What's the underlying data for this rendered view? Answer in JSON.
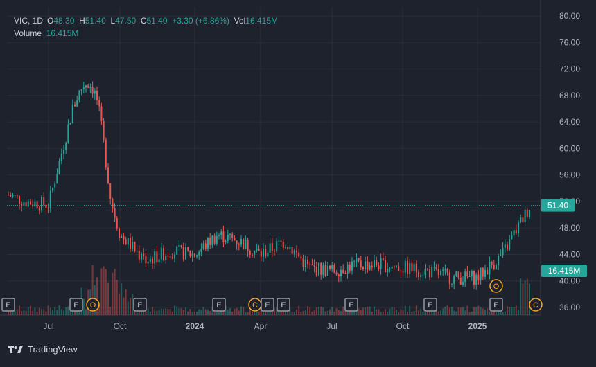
{
  "header": {
    "symbol": "VIC, 1D",
    "open_label": "O",
    "open": "48.30",
    "high_label": "H",
    "high": "51.40",
    "low_label": "L",
    "low": "47.50",
    "close_label": "C",
    "close": "51.40",
    "change": "+3.30 (+6.86%)",
    "vol_label": "Vol",
    "vol": "16.415M",
    "volume_label": "Volume",
    "volume": "16.415M"
  },
  "badges": {
    "price": "51.40",
    "volume": "16.415M"
  },
  "footer": {
    "brand": "TradingView",
    "logo_icon": "tradingview-logo-icon"
  },
  "colors": {
    "background": "#1e222d",
    "up": "#26a69a",
    "down": "#ef5350",
    "grid": "#2a2e39",
    "event_earnings": "#9598a1",
    "event_other": "#f9a825"
  },
  "chart_data": {
    "type": "candlestick",
    "title": "",
    "xlabel": "",
    "ylabel": "",
    "x_ticks": [
      "Jul",
      "Oct",
      "2024",
      "Apr",
      "Jul",
      "Oct",
      "2025"
    ],
    "y_ticks": [
      "36.00",
      "40.00",
      "44.00",
      "48.00",
      "52.00",
      "56.00",
      "60.00",
      "64.00",
      "68.00",
      "72.00",
      "76.00",
      "80.00"
    ],
    "ylim": [
      35,
      81
    ],
    "grid": true,
    "last_close": 51.4,
    "last_volume": "16.415M",
    "series": [
      {
        "name": "Close",
        "unit": "approx. monthly",
        "points": [
          {
            "x": "2023-05",
            "y": 53.0
          },
          {
            "x": "2023-06",
            "y": 52.0
          },
          {
            "x": "2023-07",
            "y": 51.5
          },
          {
            "x": "2023-08",
            "y": 66.0
          },
          {
            "x": "2023-09",
            "y": 60.0
          },
          {
            "x": "2023-10",
            "y": 47.0
          },
          {
            "x": "2023-11",
            "y": 43.0
          },
          {
            "x": "2023-12",
            "y": 44.5
          },
          {
            "x": "2024-01",
            "y": 44.0
          },
          {
            "x": "2024-02",
            "y": 47.0
          },
          {
            "x": "2024-03",
            "y": 46.0
          },
          {
            "x": "2024-04",
            "y": 44.0
          },
          {
            "x": "2024-05",
            "y": 46.0
          },
          {
            "x": "2024-06",
            "y": 42.0
          },
          {
            "x": "2024-07",
            "y": 41.5
          },
          {
            "x": "2024-08",
            "y": 42.5
          },
          {
            "x": "2024-09",
            "y": 42.5
          },
          {
            "x": "2024-10",
            "y": 42.0
          },
          {
            "x": "2024-11",
            "y": 41.5
          },
          {
            "x": "2024-12",
            "y": 40.5
          },
          {
            "x": "2025-01",
            "y": 40.5
          },
          {
            "x": "2025-02",
            "y": 44.0
          },
          {
            "x": "2025-03",
            "y": 51.4
          }
        ]
      }
    ],
    "events": [
      {
        "label": "E",
        "kind": "earnings"
      },
      {
        "label": "E",
        "kind": "earnings"
      },
      {
        "label": "O",
        "kind": "other"
      },
      {
        "label": "E",
        "kind": "earnings"
      },
      {
        "label": "E",
        "kind": "earnings"
      },
      {
        "label": "C",
        "kind": "other"
      },
      {
        "label": "E",
        "kind": "earnings"
      },
      {
        "label": "E",
        "kind": "earnings"
      },
      {
        "label": "E",
        "kind": "earnings"
      },
      {
        "label": "E",
        "kind": "earnings"
      },
      {
        "label": "E",
        "kind": "earnings"
      },
      {
        "label": "O",
        "kind": "other"
      },
      {
        "label": "C",
        "kind": "other"
      }
    ]
  }
}
